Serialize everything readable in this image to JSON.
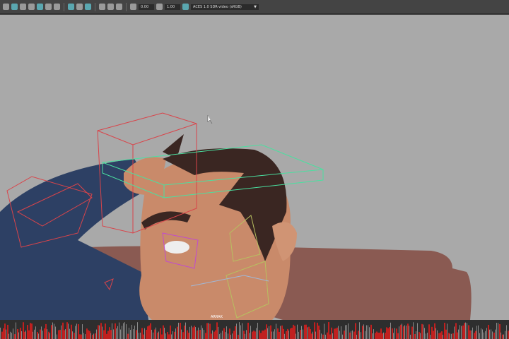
{
  "toolbar": {
    "exposure_value": "0.00",
    "gamma_value": "1.00",
    "color_space": "ACES 1.0 SDR-video (sRGB)",
    "dropdown_arrow": "▼",
    "icons": [
      "camera-icon",
      "grid-icon",
      "wireframe-icon",
      "shaded-icon",
      "textured-icon",
      "light-icon",
      "shadow-icon",
      "isolate-icon",
      "xray-icon",
      "resolution-gate-icon",
      "exposure-icon",
      "gamma-icon",
      "color-management-icon"
    ]
  },
  "viewport": {
    "background": "#a9a9a9",
    "label": "ARRAK"
  },
  "timeline": {
    "keyframe_color": "#c0201f"
  }
}
